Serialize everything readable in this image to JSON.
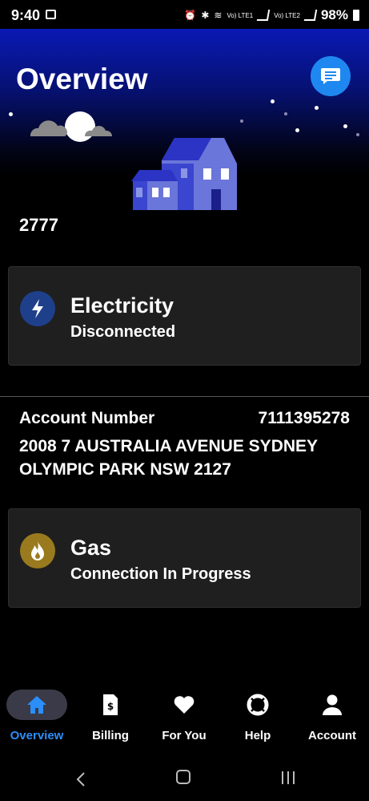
{
  "status_bar": {
    "time": "9:40",
    "network_1": "Vo) LTE1",
    "network_2": "Vo) LTE2",
    "battery": "98%"
  },
  "header": {
    "title": "Overview",
    "chat_icon": "chat-bubble-icon",
    "postcode": "2777"
  },
  "services": [
    {
      "name": "Electricity",
      "status": "Disconnected",
      "icon": "lightning-bolt-icon",
      "icon_color": "#1e3f8a"
    },
    {
      "name": "Gas",
      "status": "Connection In Progress",
      "icon": "flame-icon",
      "icon_color": "#9a7a1e"
    }
  ],
  "account": {
    "label": "Account Number",
    "number": "7111395278",
    "address": "2008 7 AUSTRALIA AVENUE SYDNEY OLYMPIC PARK NSW 2127"
  },
  "bottom_nav": [
    {
      "label": "Overview",
      "icon": "home-icon",
      "active": true
    },
    {
      "label": "Billing",
      "icon": "bill-icon",
      "active": false
    },
    {
      "label": "For You",
      "icon": "heart-icon",
      "active": false
    },
    {
      "label": "Help",
      "icon": "lifebuoy-icon",
      "active": false
    },
    {
      "label": "Account",
      "icon": "person-icon",
      "active": false
    }
  ],
  "colors": {
    "accent": "#2c8ef8",
    "hero_top": "#0a19b4",
    "card_bg": "#1f1f1f"
  }
}
